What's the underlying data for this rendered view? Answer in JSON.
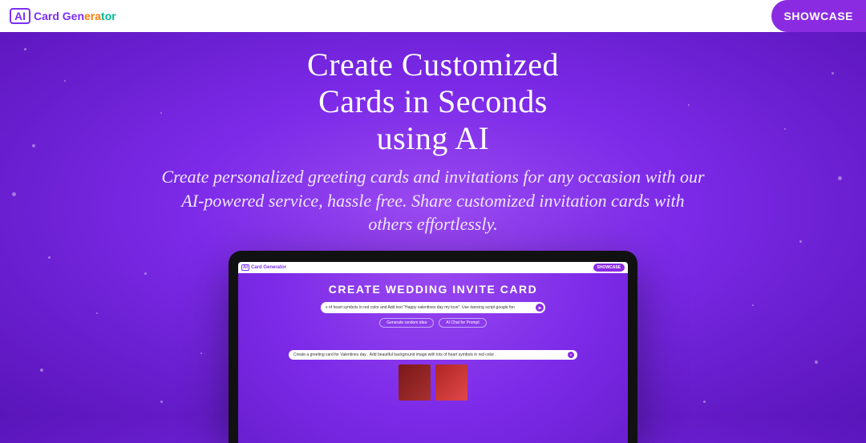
{
  "header": {
    "logo_badge": "AI",
    "logo_text": "Card Generator",
    "showcase_label": "SHOWCASE"
  },
  "hero": {
    "title_line1": "Create Customized",
    "title_line2": "Cards in Seconds",
    "title_line3": "using AI",
    "subtitle": "Create personalized greeting cards and invitations for any occasion with our AI-powered service, hassle free. Share customized invitation cards with others effortlessly."
  },
  "preview": {
    "header": {
      "logo_badge": "AI",
      "logo_text": "Card Generator",
      "showcase_label": "SHOWCASE"
    },
    "title": "CREATE WEDDING INVITE CARD",
    "prompt_input": "s of heart symbols in red color and Add text \"Happy valentines day my love\". Use dancing script google fon",
    "buttons": {
      "random": "Generate random idea",
      "chat": "AI Chat for Prompt"
    },
    "lower_input": "Create a greeting card for Valentines day . Add beautiful background image with lots of heart symbols in red color ."
  }
}
